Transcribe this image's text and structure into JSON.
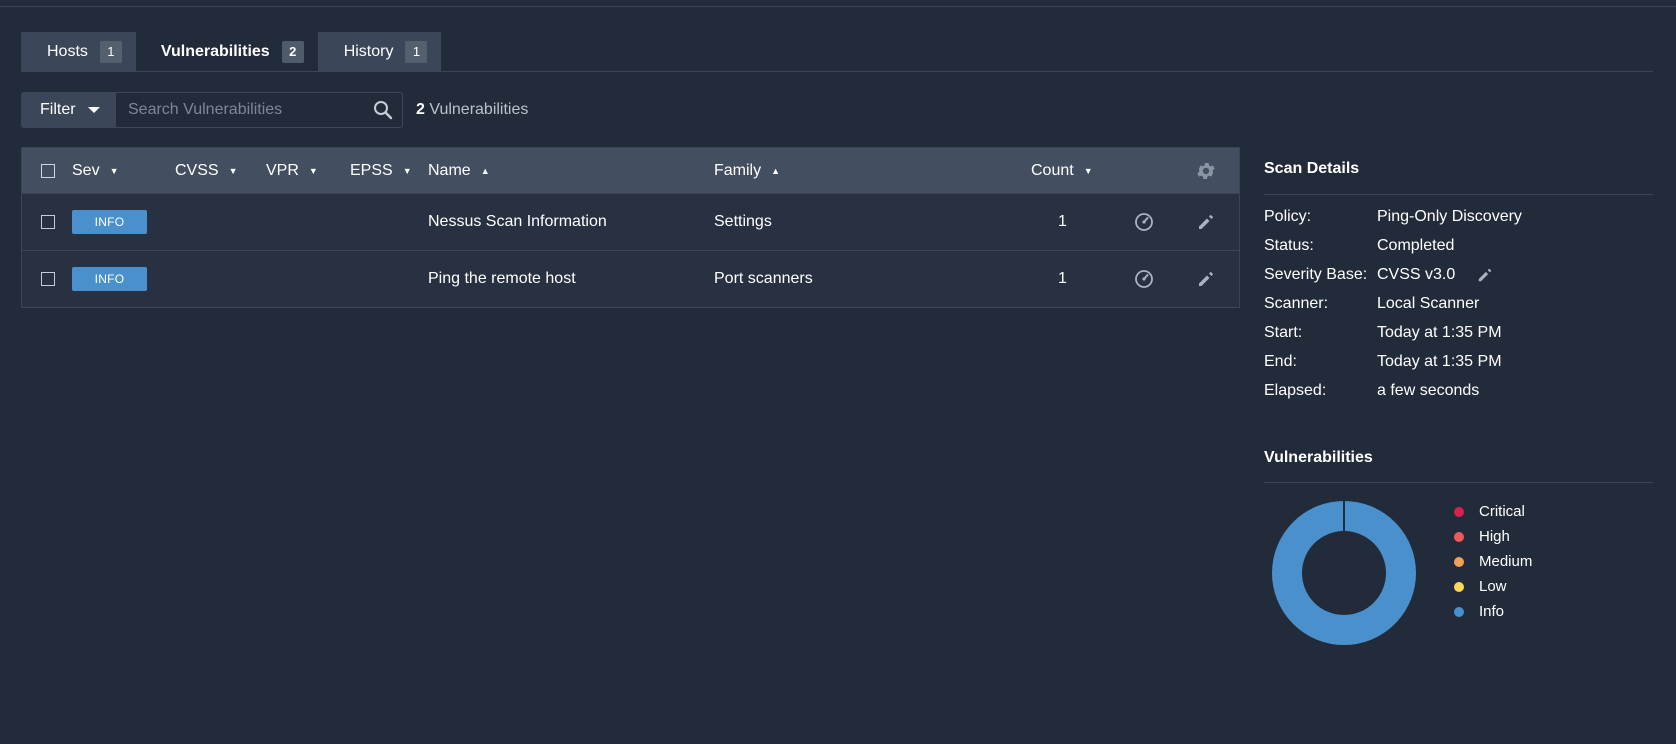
{
  "tabs": [
    {
      "label": "Hosts",
      "count": "1"
    },
    {
      "label": "Vulnerabilities",
      "count": "2"
    },
    {
      "label": "History",
      "count": "1"
    }
  ],
  "filter": {
    "label": "Filter",
    "search_placeholder": "Search Vulnerabilities",
    "result_count": "2",
    "result_label": "Vulnerabilities"
  },
  "table": {
    "columns": {
      "sev": "Sev",
      "cvss": "CVSS",
      "vpr": "VPR",
      "epss": "EPSS",
      "name": "Name",
      "family": "Family",
      "count": "Count"
    },
    "rows": [
      {
        "severity": "INFO",
        "cvss": "",
        "vpr": "",
        "epss": "",
        "name": "Nessus Scan Information",
        "family": "Settings",
        "count": "1"
      },
      {
        "severity": "INFO",
        "cvss": "",
        "vpr": "",
        "epss": "",
        "name": "Ping the remote host",
        "family": "Port scanners",
        "count": "1"
      }
    ]
  },
  "scan_details": {
    "title": "Scan Details",
    "items": [
      {
        "key": "Policy:",
        "value": "Ping-Only Discovery"
      },
      {
        "key": "Status:",
        "value": "Completed"
      },
      {
        "key": "Severity Base:",
        "value": "CVSS v3.0"
      },
      {
        "key": "Scanner:",
        "value": "Local Scanner"
      },
      {
        "key": "Start:",
        "value": "Today at 1:35 PM"
      },
      {
        "key": "End:",
        "value": "Today at 1:35 PM"
      },
      {
        "key": "Elapsed:",
        "value": "a few seconds"
      }
    ]
  },
  "vulnerabilities": {
    "title": "Vulnerabilities",
    "legend": [
      {
        "label": "Critical",
        "color": "#d8204d"
      },
      {
        "label": "High",
        "color": "#ee5a5a"
      },
      {
        "label": "Medium",
        "color": "#f0a05e"
      },
      {
        "label": "Low",
        "color": "#fbd75b"
      },
      {
        "label": "Info",
        "color": "#4a90cc"
      }
    ],
    "chart_data": {
      "type": "pie",
      "categories": [
        "Critical",
        "High",
        "Medium",
        "Low",
        "Info"
      ],
      "values": [
        0,
        0,
        0,
        0,
        2
      ]
    }
  },
  "colors": {
    "background": "#222b3a",
    "tab_inactive": "#3b4658",
    "table_header": "#434e60",
    "info_badge": "#4a90cc"
  }
}
